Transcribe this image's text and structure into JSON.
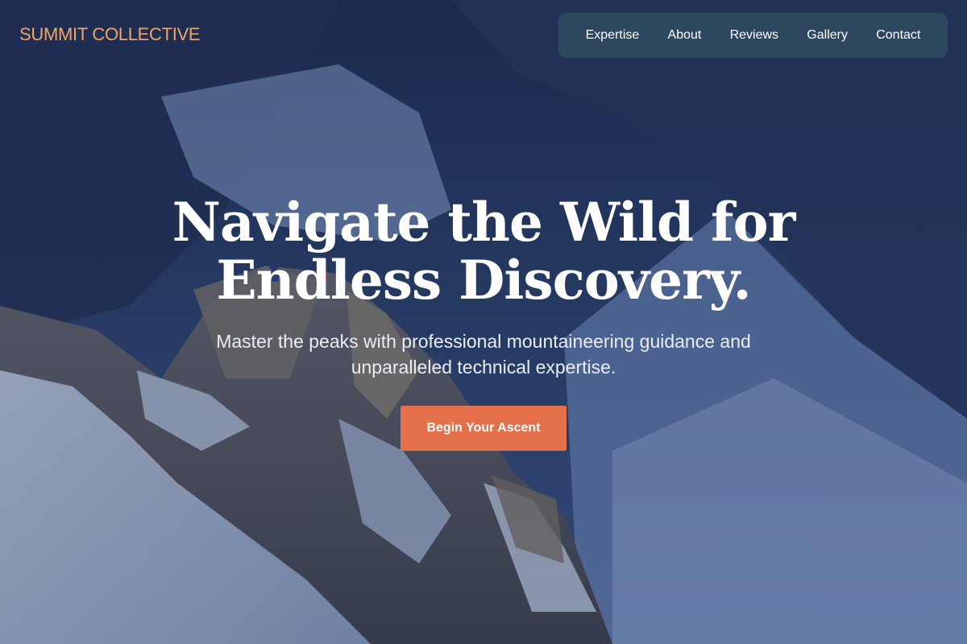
{
  "brand": {
    "logo_text": "SUMMIT COLLECTIVE",
    "logo_color": "#f0a46a"
  },
  "nav": {
    "items": [
      {
        "label": "Expertise"
      },
      {
        "label": "About"
      },
      {
        "label": "Reviews"
      },
      {
        "label": "Gallery"
      },
      {
        "label": "Contact"
      }
    ]
  },
  "hero": {
    "headline_line1": "Navigate the Wild for",
    "headline_line2": "Endless Discovery.",
    "subheadline_line1": "Master the peaks with professional mountaineering guidance and",
    "subheadline_line2": "unparalleled technical expertise.",
    "cta_label": "Begin Your Ascent",
    "cta_color": "#e4704a",
    "background_image": "snowy-mountain-photo"
  }
}
